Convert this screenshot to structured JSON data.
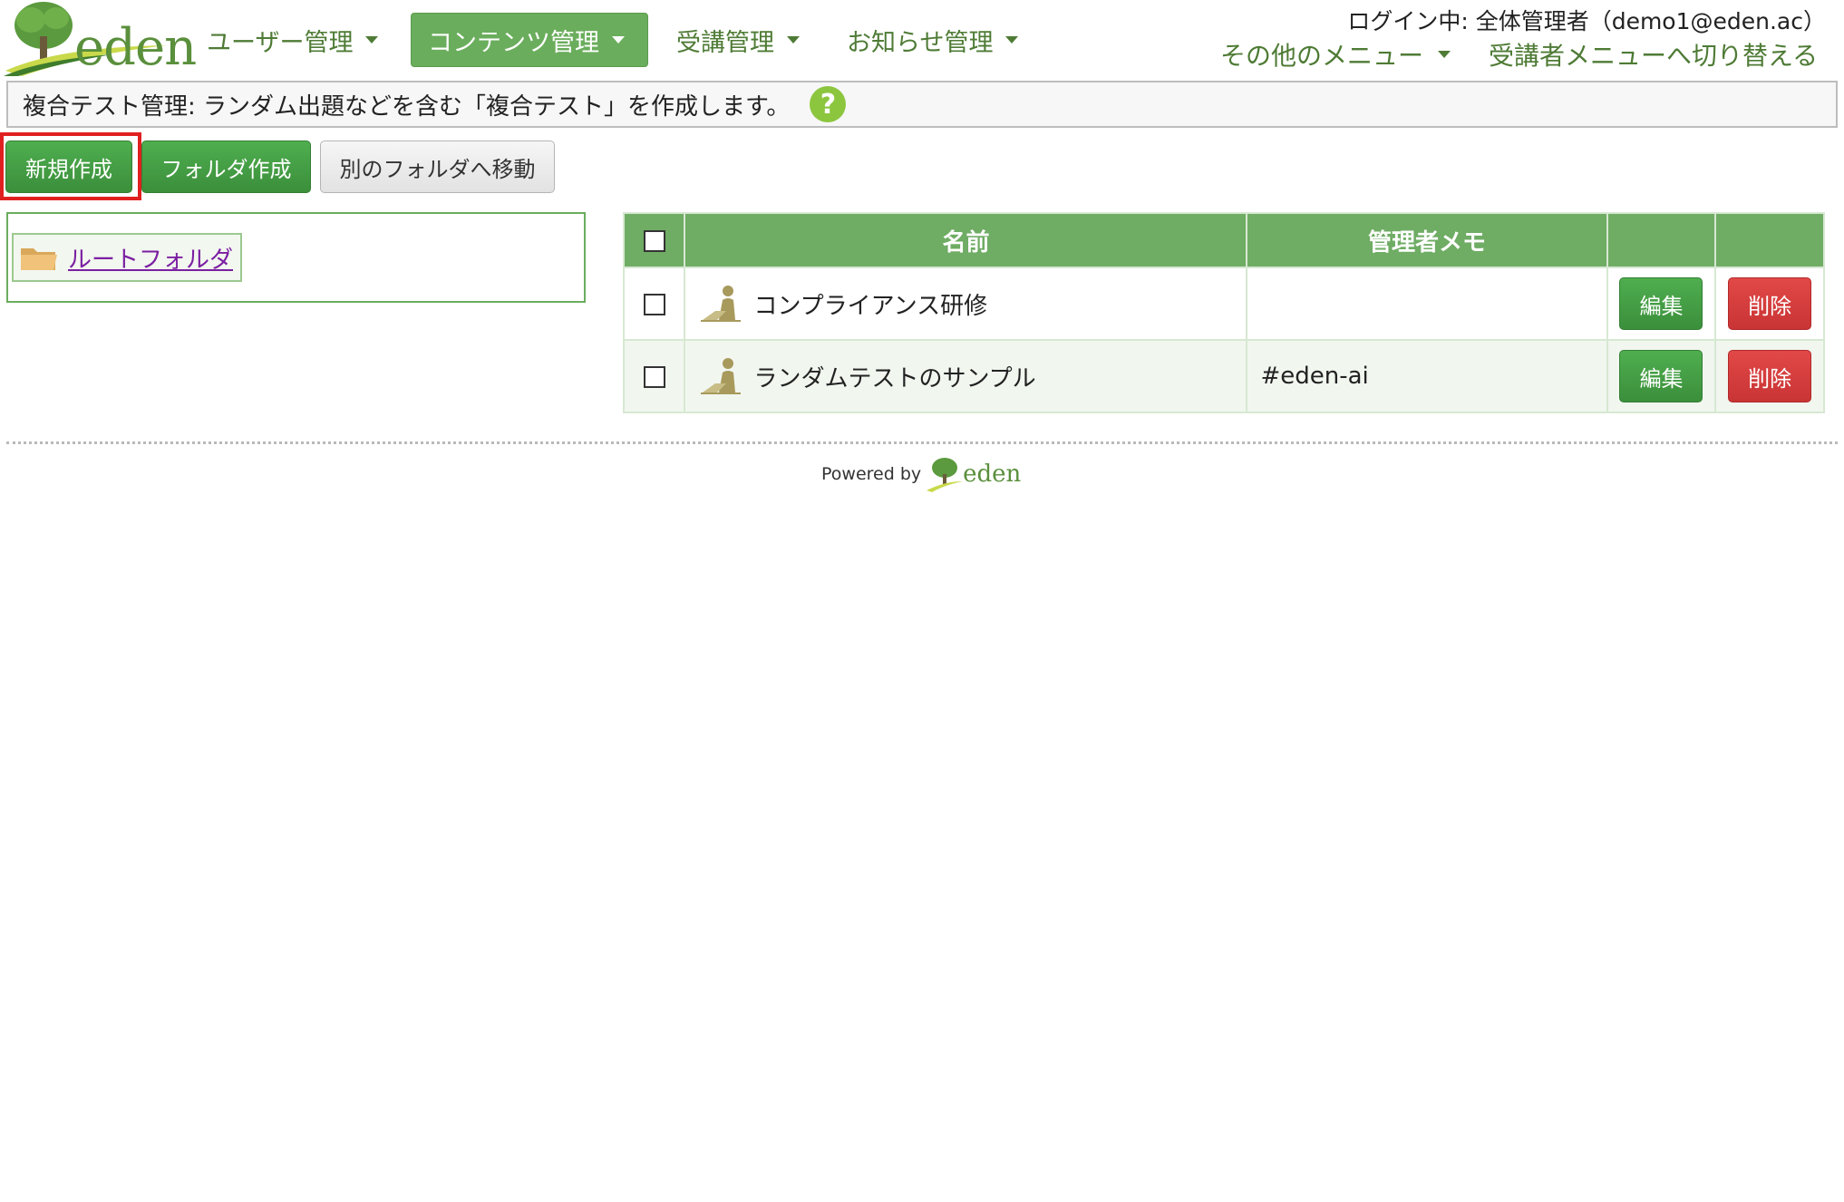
{
  "brand": {
    "logo_text": "eden"
  },
  "nav": {
    "items": [
      {
        "label": "ユーザー管理"
      },
      {
        "label": "コンテンツ管理"
      },
      {
        "label": "受講管理"
      },
      {
        "label": "お知らせ管理"
      }
    ],
    "login_status": "ログイン中: 全体管理者（demo1@eden.ac）",
    "other_menu": "その他のメニュー",
    "switch_menu": "受講者メニューへ切り替える"
  },
  "description": "複合テスト管理: ランダム出題などを含む「複合テスト」を作成します。",
  "help_icon_char": "?",
  "toolbar": {
    "new_label": "新規作成",
    "folder_label": "フォルダ作成",
    "move_label": "別のフォルダへ移動"
  },
  "tree": {
    "root_label": "ルートフォルダ"
  },
  "table": {
    "headers": {
      "name": "名前",
      "memo": "管理者メモ"
    },
    "rows": [
      {
        "name": "コンプライアンス研修",
        "memo": "",
        "edit_label": "編集",
        "delete_label": "削除"
      },
      {
        "name": "ランダムテストのサンプル",
        "memo": "#eden-ai",
        "edit_label": "編集",
        "delete_label": "削除"
      }
    ]
  },
  "footer": {
    "powered_by": "Powered by",
    "logo_text": "eden"
  },
  "colors": {
    "brand_green": "#5a8f3c",
    "header_green": "#6fac64",
    "danger_red": "#d23b3b",
    "highlight": "#e02020"
  },
  "icons": [
    "tree-logo-icon",
    "caret-down-icon",
    "help-icon",
    "folder-icon",
    "learner-icon"
  ]
}
